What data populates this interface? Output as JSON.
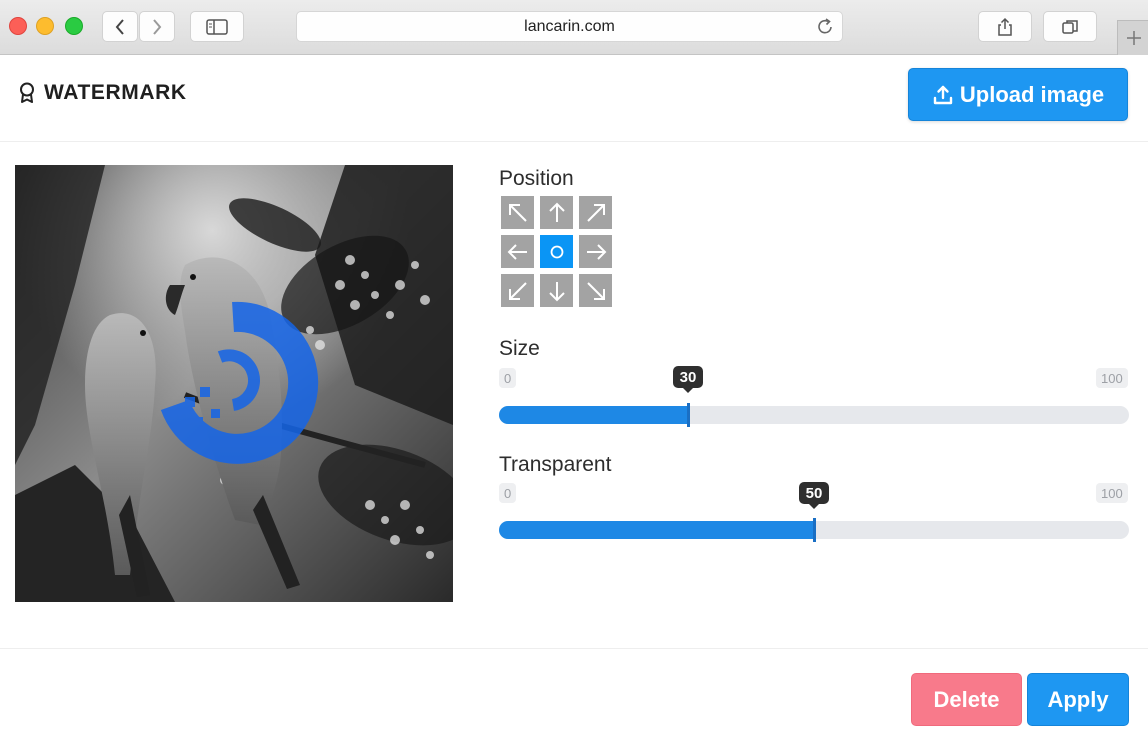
{
  "browser": {
    "url": "lancarin.com",
    "icons": [
      "back-icon",
      "forward-icon",
      "sidebar-icon",
      "reload-icon",
      "share-icon",
      "tabs-icon",
      "plus-icon"
    ]
  },
  "header": {
    "title": "WATERMARK",
    "title_icon": "award-icon",
    "upload_label": "Upload image",
    "upload_icon": "upload-icon"
  },
  "controls": {
    "position": {
      "label": "Position",
      "selected": "center",
      "cells": [
        "top-left",
        "top",
        "top-right",
        "left",
        "center",
        "right",
        "bottom-left",
        "bottom",
        "bottom-right"
      ]
    },
    "size": {
      "label": "Size",
      "min": "0",
      "max": "100",
      "value": "30",
      "fraction": 0.3
    },
    "transparent": {
      "label": "Transparent",
      "min": "0",
      "max": "100",
      "value": "50",
      "fraction": 0.5
    }
  },
  "footer": {
    "delete_label": "Delete",
    "apply_label": "Apply"
  },
  "colors": {
    "primary": "#1e97f2",
    "danger": "#f87a8b",
    "slider_fill": "#1e88e5",
    "position_active": "#0a95f5",
    "position_inactive": "#a3a3a3"
  }
}
